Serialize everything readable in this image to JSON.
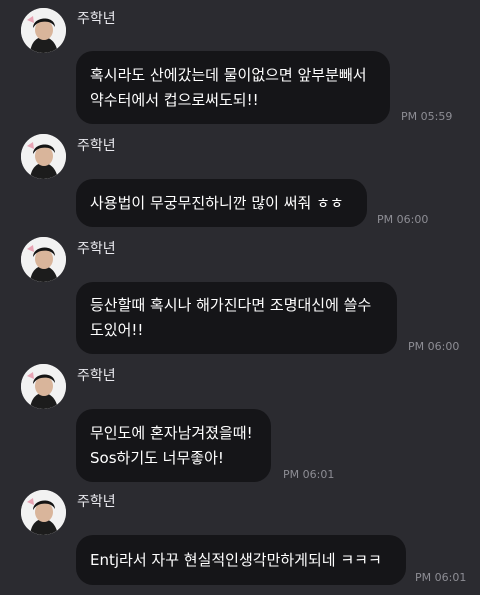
{
  "sender": {
    "name": "주학년"
  },
  "messages": [
    {
      "text": "혹시라도 산에갔는데 물이없으면 앞부분빼서\n약수터에서 컵으로써도되!!",
      "time": "PM 05:59"
    },
    {
      "text": "사용법이 무궁무진하니깐 많이 써줘 ㅎㅎ",
      "time": "PM 06:00"
    },
    {
      "text": "등산할때 혹시나 해가진다면 조명대신에 쓸수\n도있어!!",
      "time": "PM 06:00"
    },
    {
      "text": "무인도에 혼자남겨졌을때!\nSos하기도 너무좋아!",
      "time": "PM 06:01"
    },
    {
      "text": "Entj라서 자꾸 현실적인생각만하게되네 ㅋㅋㅋ",
      "time": "PM 06:01"
    }
  ],
  "colors": {
    "background": "#2b2b30",
    "bubble": "#151518",
    "timestamp": "#8d8d94"
  }
}
